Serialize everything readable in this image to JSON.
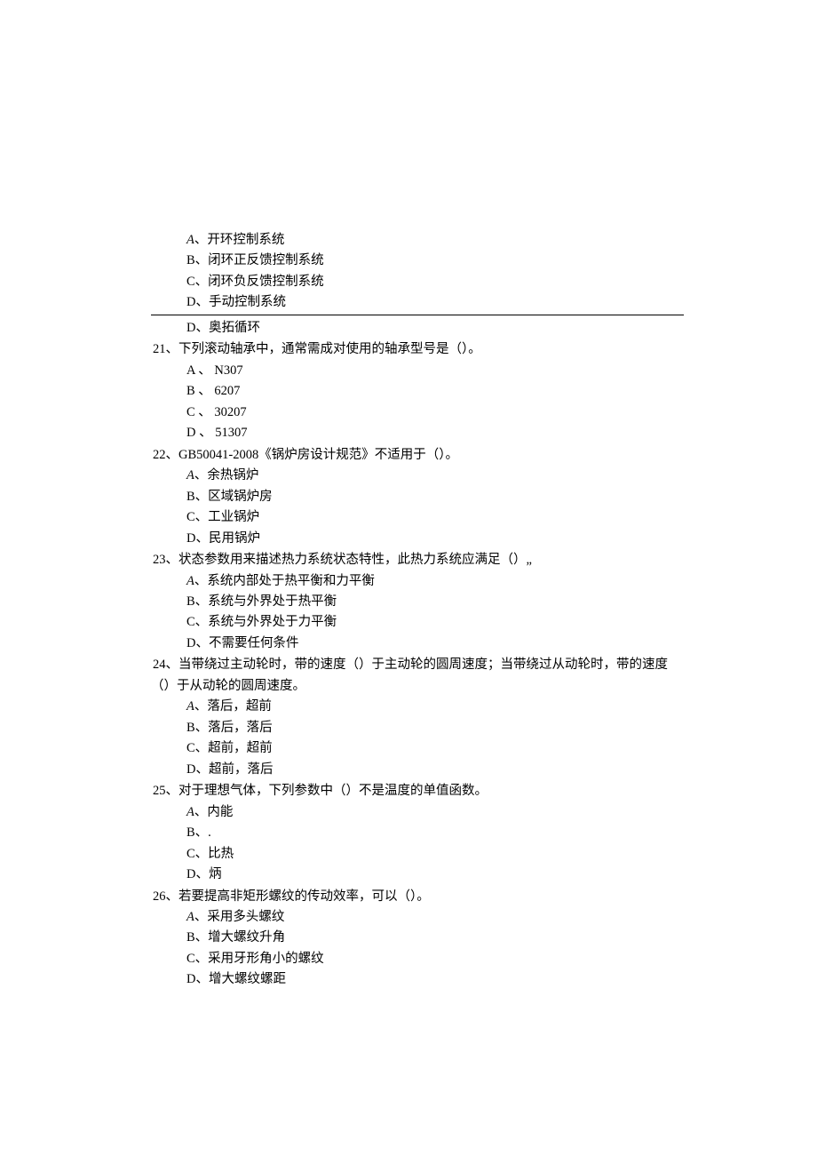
{
  "leadin_options": {
    "a": "A、开环控制系统",
    "b": "B、闭环正反馈控制系统",
    "c": "C、闭环负反馈控制系统",
    "d": "D、手动控制系统"
  },
  "orphan_d": "D、奥拓循环",
  "questions": [
    {
      "num": "21、",
      "stem": "下列滚动轴承中，通常需成对使用的轴承型号是（）。",
      "opts": {
        "a": "A 、 N307",
        "b": "B 、 6207",
        "c": "C 、 30207",
        "d": "D 、 51307"
      }
    },
    {
      "num": "22、",
      "stem": "GB50041-2008《锅炉房设计规范》不适用于（）。",
      "opts": {
        "a": "A、余热锅炉",
        "b": "B、区域锅炉房",
        "c": "C、工业锅炉",
        "d": "D、民用锅炉"
      }
    },
    {
      "num": "23、",
      "stem": "状态参数用来描述热力系统状态特性，此热力系统应满足（）„",
      "opts": {
        "a": "A、系统内部处于热平衡和力平衡",
        "b": "B、系统与外界处于热平衡",
        "c": "C、系统与外界处于力平衡",
        "d": "D、不需要任何条件"
      }
    },
    {
      "num": "24、",
      "stem": "当带绕过主动轮时，带的速度（）于主动轮的圆周速度；当带绕过从动轮时，带的速度",
      "stem2": "（）于从动轮的圆周速度。",
      "opts": {
        "a": "A、落后，超前",
        "b": "B、落后，落后",
        "c": "C、超前，超前",
        "d": "D、超前，落后"
      }
    },
    {
      "num": "25、",
      "stem": "对于理想气体，下列参数中（）不是温度的单值函数。",
      "opts": {
        "a": "A、内能",
        "b": "B、.",
        "c": "C、比热",
        "d": "D、炳"
      }
    },
    {
      "num": "26、",
      "stem": "若要提高非矩形螺纹的传动效率，可以（）。",
      "opts": {
        "a": "A、采用多头螺纹",
        "b": "B、增大螺纹升角",
        "c": "C、采用牙形角小的螺纹",
        "d": "D、增大螺纹螺距"
      }
    }
  ]
}
